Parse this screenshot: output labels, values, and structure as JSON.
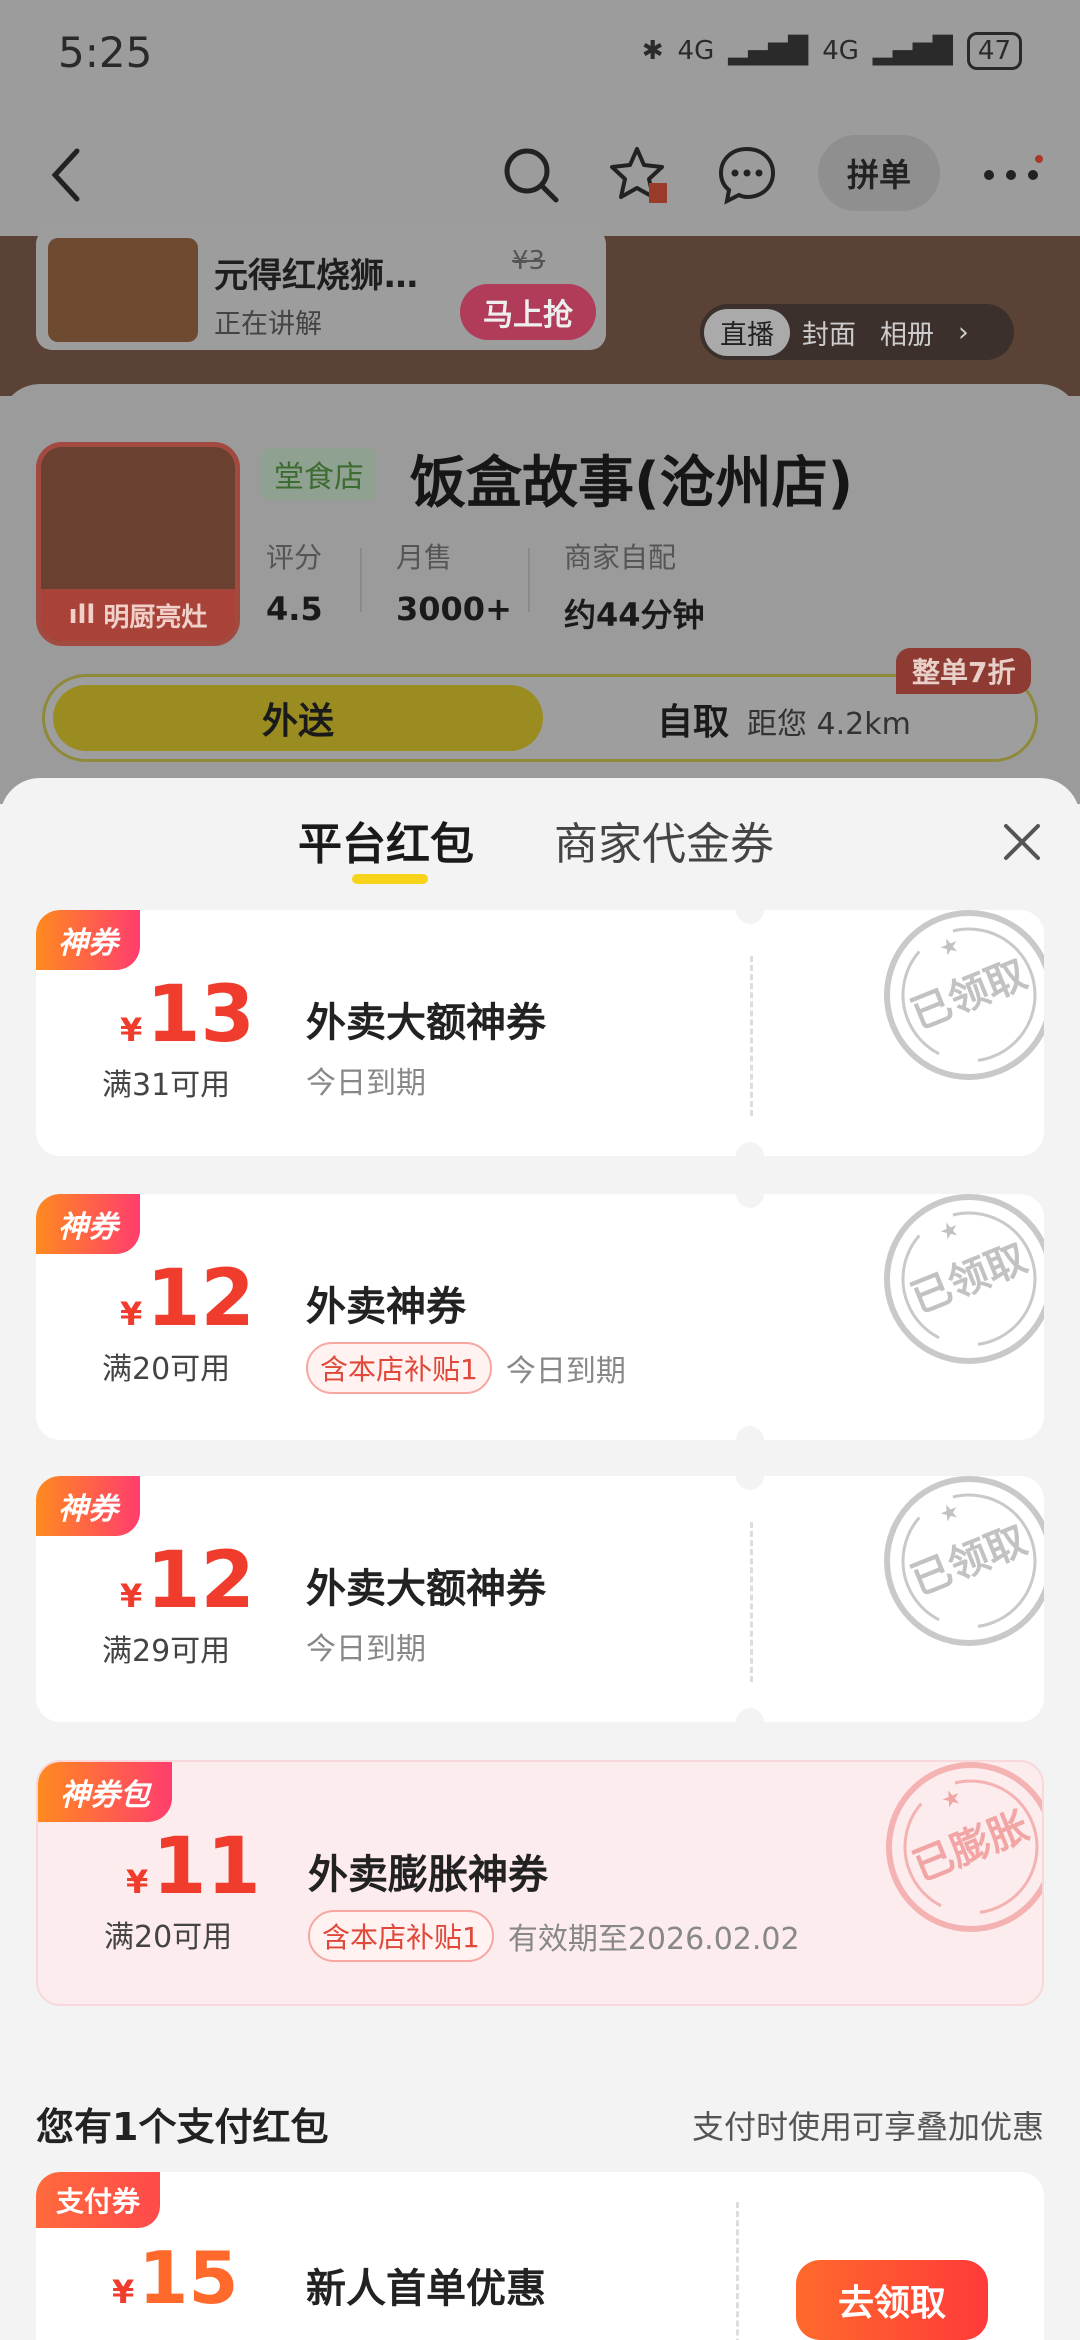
{
  "status": {
    "time": "5:25",
    "net1": "4G",
    "net2": "4G",
    "battery": "47"
  },
  "nav": {
    "group_label": "拼单"
  },
  "live": {
    "title": "元得红烧狮…",
    "subtitle": "正在讲解",
    "old_price": "¥3",
    "cta": "马上抢",
    "tabs": [
      "直播",
      "封面",
      "相册"
    ]
  },
  "shop": {
    "logo_tag": "明厨亮灶",
    "type_tag": "堂食店",
    "name": "饭盒故事(沧州店)",
    "stats": [
      {
        "label": "评分",
        "value": "4.5"
      },
      {
        "label": "月售",
        "value": "3000+"
      },
      {
        "label": "商家自配",
        "value": "约44分钟"
      }
    ],
    "discount_badge": "整单7折",
    "mode_delivery": "外送",
    "mode_pickup": "自取",
    "distance": "距您 4.2km"
  },
  "sheet": {
    "tabs": [
      "平台红包",
      "商家代金券"
    ]
  },
  "coupons": [
    {
      "tag": "神券",
      "currency": "¥",
      "amount": "13",
      "condition": "满31可用",
      "title": "外卖大额神券",
      "chip": "",
      "expiry": "今日到期",
      "stamp": "已领取"
    },
    {
      "tag": "神券",
      "currency": "¥",
      "amount": "12",
      "condition": "满20可用",
      "title": "外卖神券",
      "chip": "含本店补贴1",
      "expiry": "今日到期",
      "stamp": "已领取"
    },
    {
      "tag": "神券",
      "currency": "¥",
      "amount": "12",
      "condition": "满29可用",
      "title": "外卖大额神券",
      "chip": "",
      "expiry": "今日到期",
      "stamp": "已领取"
    },
    {
      "tag": "神券包",
      "currency": "¥",
      "amount": "11",
      "condition": "满20可用",
      "title": "外卖膨胀神券",
      "chip": "含本店补贴1",
      "expiry": "有效期至2026.02.02",
      "stamp": "已膨胀"
    }
  ],
  "pay": {
    "heading": "您有1个支付红包",
    "hint": "支付时使用可享叠加优惠",
    "tag": "支付券",
    "currency": "¥",
    "amount": "15",
    "title": "新人首单优惠",
    "button": "去领取"
  }
}
